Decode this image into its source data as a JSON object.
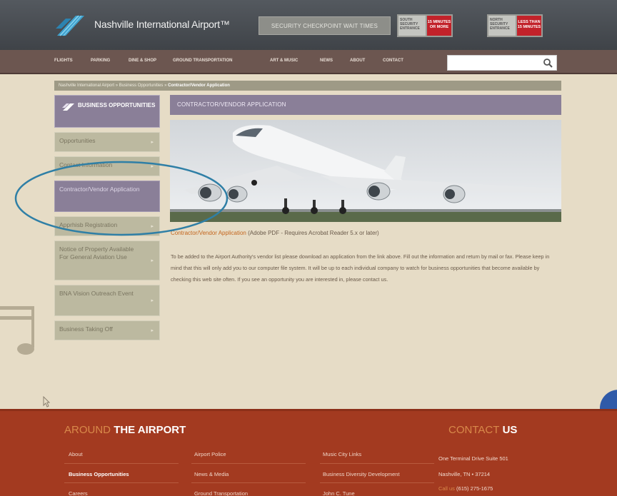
{
  "header": {
    "site_name": "Nashville International Airport™",
    "wait_times_label": "SECURITY CHECKPOINT WAIT TIMES",
    "checkpoints": [
      {
        "label": "SOUTH SECURITY ENTRANCE",
        "time": "15 MINUTES OR MORE"
      },
      {
        "label": "NORTH SECURITY ENTRANCE",
        "time": "LESS THAN 15 MINUTES"
      }
    ]
  },
  "nav": {
    "items": [
      "FLIGHTS",
      "PARKING",
      "DINE & SHOP",
      "GROUND TRANSPORTATION",
      "ART & MUSIC",
      "NEWS",
      "ABOUT",
      "CONTACT"
    ],
    "search_placeholder": ""
  },
  "breadcrumb": {
    "items": [
      "Nashville International Airport",
      "Business Opportunities"
    ],
    "current": "Contractor/Vendor Application"
  },
  "sidebar": {
    "title": "BUSINESS OPPORTUNITIES",
    "items": [
      "Opportunities",
      "Contact Information",
      "Contractor/Vendor Application",
      "Apprhisb Registration",
      "Notice of Property Available For General Aviation Use",
      "BNA Vision Outreach Event",
      "Business Taking Off"
    ],
    "active_index": 2
  },
  "content": {
    "title": "CONTRACTOR/VENDOR APPLICATION",
    "pdf_link": "Contractor/Vendor Application",
    "pdf_note": "(Adobe PDF - Requires Acrobat Reader 5.x or later)",
    "body": "To be added to the Airport Authority's vendor list please download an application from the link above. Fill out the information and return by mail or fax. Please keep in mind that this will only add you to our computer file system. It will be up to each individual company to watch for business opportunities that become available by checking this web site often. If you see an opportunity you are interested in, please contact us."
  },
  "footer": {
    "around_highlight": "AROUND",
    "around_rest": "THE AIRPORT",
    "col1": [
      "About",
      "Business Opportunities",
      "Careers"
    ],
    "col2": [
      "Airport Police",
      "News & Media",
      "Ground Transportation"
    ],
    "col3": [
      "Music City Links",
      "Business Diversity Development",
      "John C. Tune"
    ],
    "contact_highlight": "CONTACT",
    "contact_rest": "US",
    "address1": "One Terminal Drive Suite 501",
    "address2": "Nashville, TN • 37214",
    "phone_label": "Call us",
    "phone": "(615) 275-1675"
  },
  "colors": {
    "header_bg": "#4a4e53",
    "nav_bg": "#6c5650",
    "accent_purple": "#8a7f98",
    "sidebar_item": "#bcb9a0",
    "footer_bg": "#a33a20",
    "checkpoint_red": "#c2222a",
    "highlight_ring": "#2f7fa6"
  }
}
